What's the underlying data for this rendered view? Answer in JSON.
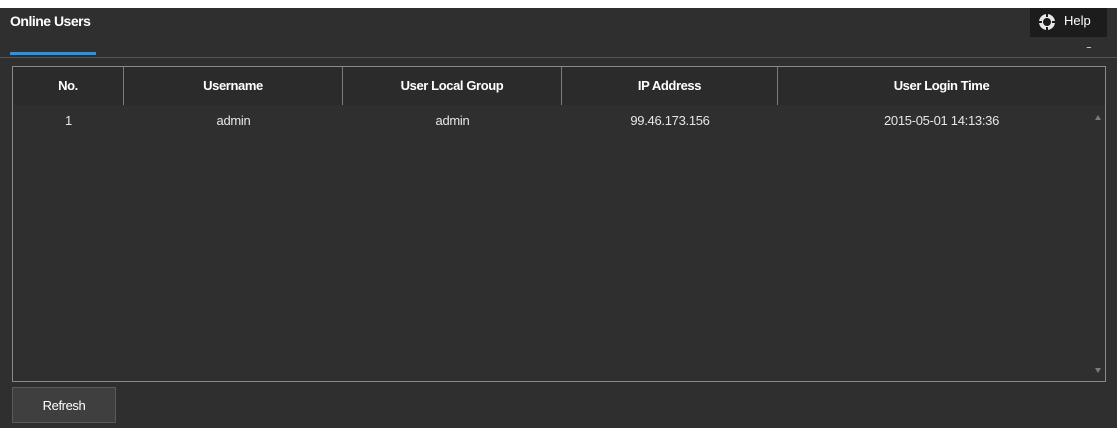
{
  "tabs": [
    {
      "label": "Online Users"
    }
  ],
  "help": {
    "label": "Help",
    "icon": "lifebuoy-icon",
    "partial_text": "O"
  },
  "table": {
    "columns": [
      "No.",
      "Username",
      "User Local Group",
      "IP Address",
      "User Login Time"
    ],
    "rows": [
      {
        "no": "1",
        "username": "admin",
        "group": "admin",
        "ip": "99.46.173.156",
        "login_time": "2015-05-01 14:13:36"
      }
    ]
  },
  "actions": {
    "refresh_label": "Refresh"
  },
  "colors": {
    "background": "#2f2f2f",
    "tab_accent": "#3a8fd0",
    "text": "#ffffff"
  }
}
